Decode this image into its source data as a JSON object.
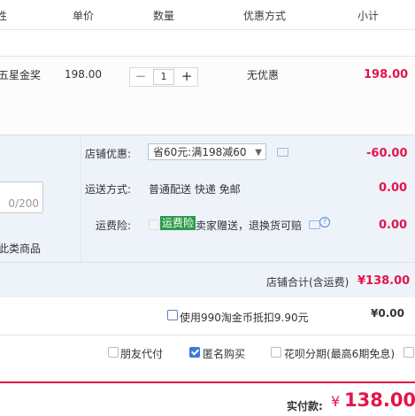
{
  "header": {
    "col_product_tail": "性",
    "col_unit_price": "单价",
    "col_quantity": "数量",
    "col_discount": "优惠方式",
    "col_subtotal": "小计"
  },
  "item": {
    "name_fragment": "五星金奖",
    "unit_price": "198.00",
    "quantity": "1",
    "minus": "−",
    "plus": "+",
    "discount": "无优惠",
    "subtotal": "198.00"
  },
  "shop": {
    "coupon_label": "店铺优惠:",
    "coupon_selected": "省60元:满198减60",
    "coupon_amount": "-60.00",
    "shipping_label": "运送方式:",
    "shipping_value": "普通配送 快递 免邮",
    "shipping_amount": "0.00",
    "insurance_label": "运费险:",
    "insurance_tag": "运费险",
    "insurance_text": "卖家赠送，退换货可赔",
    "insurance_amount": "0.00",
    "message_counter": "0/200",
    "similar_items_fragment": "此类商品",
    "total_label": "店铺合计(含运费)",
    "total_value": "¥138.00"
  },
  "taobao_coin": {
    "label": "使用990淘金币抵扣9.90元",
    "amount": "¥0.00"
  },
  "options": [
    {
      "label": "朋友代付",
      "checked": false
    },
    {
      "label": "匿名购买",
      "checked": true
    },
    {
      "label": "花呗分期(最高6期免息)",
      "checked": false
    }
  ],
  "payment": {
    "label": "实付款:",
    "currency": "¥",
    "amount": "138.00"
  },
  "colors": {
    "accent_red": "#e4154b",
    "panel_blue": "#eef3fa",
    "checkbox_blue": "#3d7bd6",
    "tag_green": "#2f9a4a"
  },
  "icons": [
    "message-icon",
    "chevron-down-icon",
    "help-icon"
  ]
}
